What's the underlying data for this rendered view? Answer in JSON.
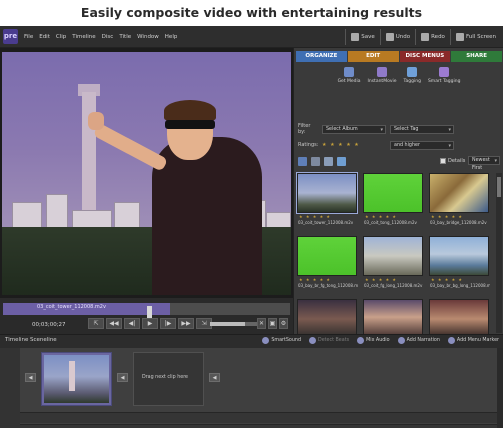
{
  "headline": "Easily composite video with entertaining results",
  "app": {
    "logo_text": "pre",
    "menus": [
      "File",
      "Edit",
      "Clip",
      "Timeline",
      "Disc",
      "Title",
      "Window",
      "Help"
    ],
    "top_buttons": [
      "Save",
      "Undo",
      "Redo",
      "Full Screen"
    ]
  },
  "monitor": {
    "clip_name": "03_coit_tower_112008.m2v",
    "timecode": "00;03;00;27",
    "transport": [
      "⇱",
      "◀◀",
      "◀|",
      "▶",
      "|▶",
      "▶▶",
      "⇲"
    ],
    "end_buttons": [
      "✕",
      "▣",
      "⚙"
    ],
    "volume": 0.7
  },
  "panel": {
    "tabs": [
      {
        "label": "ORGANIZE",
        "color": "#3f6fb3"
      },
      {
        "label": "EDIT",
        "color": "#b87a22"
      },
      {
        "label": "DISC MENUS",
        "color": "#8a2a2a"
      },
      {
        "label": "SHARE",
        "color": "#2f7a3a"
      }
    ],
    "tasks": [
      {
        "label": "Get Media",
        "color": "#6f8cc9"
      },
      {
        "label": "InstantMovie",
        "color": "#8f7ac9"
      },
      {
        "label": "Tagging",
        "color": "#6fa0d9"
      },
      {
        "label": "Smart Tagging",
        "color": "#9c7bd1"
      }
    ],
    "filter_by_label": "Filter by:",
    "filter_album": "Select Album",
    "filter_tag": "Select Tag",
    "ratings_label": "Ratings:",
    "ratings_stars": "★ ★ ★ ★ ★",
    "ratings_mode": "and higher",
    "details_label": "Details",
    "sort": "Newest First",
    "clips": [
      {
        "name": "03_coit_tower_112008.m2v",
        "kind": "tower",
        "selected": true
      },
      {
        "name": "03_coit_tong_112008.m2v",
        "kind": "green",
        "selected": false
      },
      {
        "name": "03_bay_bridge_112008.m2v",
        "kind": "bridge",
        "selected": false
      },
      {
        "name": "03_bay_br_fg_tong_112008.m2v",
        "kind": "green",
        "selected": false
      },
      {
        "name": "03_coit_fg_long_112008.m2v",
        "kind": "city",
        "selected": false
      },
      {
        "name": "03_bay_br_bg_long_112008.m2v",
        "kind": "bay",
        "selected": false
      },
      {
        "name": "",
        "kind": "kids",
        "selected": false
      },
      {
        "name": "",
        "kind": "kids2",
        "selected": false
      },
      {
        "name": "",
        "kind": "kids3",
        "selected": false
      }
    ]
  },
  "timeline": {
    "tabs": [
      "Timeline",
      "Sceneline"
    ],
    "buttons": [
      {
        "label": "SmartSound",
        "dim": false
      },
      {
        "label": "Detect Beats",
        "dim": true
      },
      {
        "label": "Mix Audio",
        "dim": false
      },
      {
        "label": "Add Narration",
        "dim": false
      },
      {
        "label": "Add Menu Marker",
        "dim": false
      }
    ],
    "drop_text": "Drag next clip here"
  }
}
